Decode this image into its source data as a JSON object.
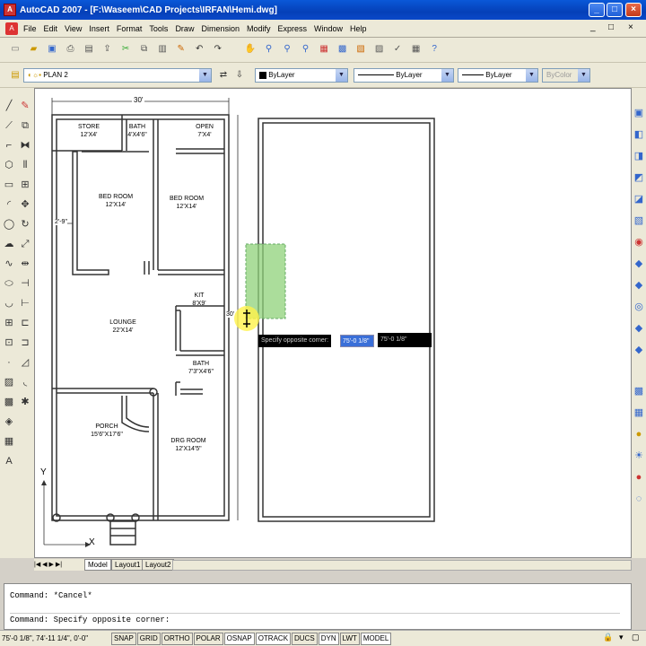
{
  "window": {
    "title": "AutoCAD 2007 - [F:\\Waseem\\CAD Projects\\IRFAN\\Hemi.dwg]",
    "app_icon": "A",
    "controls": [
      "_",
      "□",
      "×"
    ],
    "doc_controls": [
      "_",
      "□",
      "×"
    ]
  },
  "menu": {
    "items": [
      "File",
      "Edit",
      "View",
      "Insert",
      "Format",
      "Tools",
      "Draw",
      "Dimension",
      "Modify",
      "Express",
      "Window",
      "Help"
    ]
  },
  "layers": {
    "layer_name": "PLAN 2",
    "color": "ByLayer",
    "linetype": "ByLayer",
    "lineweight": "ByLayer",
    "plotstyle": "ByColor"
  },
  "plan": {
    "overall_dim": "30'",
    "side_dim": "2'-9\"",
    "rooms": [
      {
        "name": "STORE",
        "size": "12'X4'"
      },
      {
        "name": "BATH",
        "size": "4'X4'6\""
      },
      {
        "name": "OPEN",
        "size": "7'X4'"
      },
      {
        "name": "BED ROOM",
        "size": "12'X14'"
      },
      {
        "name": "BED ROOM",
        "size": "12'X14'"
      },
      {
        "name": "KIT",
        "size": "8'X9'"
      },
      {
        "name": "LOUNGE",
        "size": "22'X14'"
      },
      {
        "name": "BATH",
        "size": "7'3\"X4'6\""
      },
      {
        "name": "PORCH",
        "size": "15'6\"X17'6\""
      },
      {
        "name": "DRG ROOM",
        "size": "12'X14'5\""
      }
    ],
    "axis_x": "X",
    "axis_y": "Y",
    "side_label": "30'"
  },
  "tooltip": {
    "prompt": "Specify opposite corner:",
    "value1": "75'-0 1/8\"",
    "value2": "75'-0 1/8\""
  },
  "tabs": [
    "Model",
    "Layout1",
    "Layout2"
  ],
  "command": {
    "line1": "Command: *Cancel*",
    "line2": "Command: Specify opposite corner:"
  },
  "status": {
    "coords": "75'-0 1/8\",  74'-11 1/4\",  0'-0\"",
    "toggles": [
      "SNAP",
      "GRID",
      "ORTHO",
      "POLAR",
      "OSNAP",
      "OTRACK",
      "DUCS",
      "DYN",
      "LWT",
      "MODEL"
    ]
  },
  "colors": {
    "titlebar": "#0a58d8",
    "selection_window": "#8fd17a",
    "highlight": "#fff24a"
  }
}
